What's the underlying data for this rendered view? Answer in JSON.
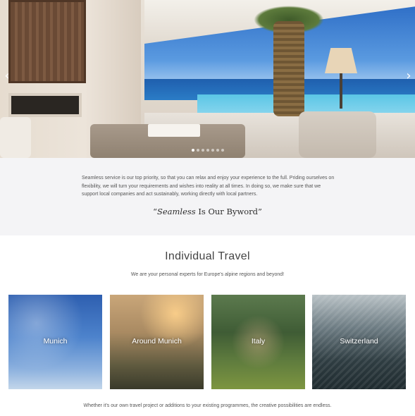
{
  "hero": {
    "image_alt": "Villa living room with terrace, pool and sea view",
    "prev_icon": "chevron-left-icon",
    "next_icon": "chevron-right-icon",
    "prev_glyph": "‹",
    "next_glyph": "›",
    "slides": [
      {
        "active": true
      },
      {
        "active": false
      },
      {
        "active": false
      },
      {
        "active": false
      },
      {
        "active": false
      },
      {
        "active": false
      },
      {
        "active": false
      }
    ]
  },
  "intro": {
    "text": "Seamless service is our top priority, so that you can relax and enjoy your experience to the full. Priding ourselves on flexibility, we will turn your requirements and wishes into reality at all times. In doing so, we make sure that we support local companies and act sustainably, working directly with local partners.",
    "quote_open": "“",
    "quote_emphasis": "Seamless",
    "quote_rest": " Is Our Byword”"
  },
  "section": {
    "title": "Individual Travel",
    "subtitle": "We are your personal experts for Europe's alpine regions and beyond!"
  },
  "destinations": [
    {
      "label": "Munich"
    },
    {
      "label": "Around Munich"
    },
    {
      "label": "Italy"
    },
    {
      "label": "Switzerland"
    }
  ],
  "footer_text": "Whether it's our own travel project or additions to your existing programmes, the creative possibilities are endless.",
  "colors": {
    "intro_band": "#f4f4f6",
    "text": "#555555",
    "card_label": "#ffffff"
  }
}
